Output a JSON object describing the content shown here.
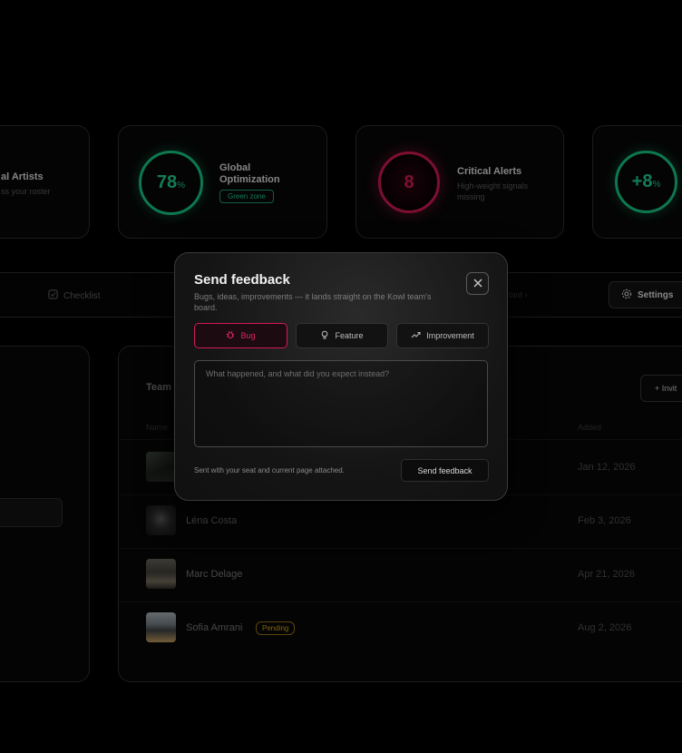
{
  "stats": [
    {
      "title": "al Artists",
      "subtitle": "ss your roster"
    },
    {
      "value": "78",
      "unit": "%",
      "title_line1": "Global",
      "title_line2": "Optimization",
      "badge": "Green zone",
      "accent": "#14b87a"
    },
    {
      "value": "8",
      "title": "Critical Alerts",
      "subtitle_line1": "High-weight signals",
      "subtitle_line2": "missing",
      "accent": "#c1184c"
    },
    {
      "value": "+8",
      "unit": "%",
      "accent": "#14b87a"
    }
  ],
  "toolbar": {
    "checklist_label": "Checklist",
    "hidden_label": "tant",
    "settings_label": "Settings"
  },
  "team": {
    "title": "Team",
    "invite_label": "+ Invit",
    "col_name": "Name",
    "col_added": "Added",
    "members": [
      {
        "name": "",
        "added": "Jan 12, 2026"
      },
      {
        "name": "Léna Costa",
        "added": "Feb 3, 2026"
      },
      {
        "name": "Marc Delage",
        "added": "Apr 21, 2026"
      },
      {
        "name": "Sofia Amrani",
        "added": "Aug 2, 2026",
        "badge": "Pending"
      }
    ]
  },
  "modal": {
    "title": "Send feedback",
    "subtitle": "Bugs, ideas, improvements — it lands straight on the Kowl team's board.",
    "types": [
      {
        "label": "Bug",
        "icon": "bug-icon",
        "active": true
      },
      {
        "label": "Feature",
        "icon": "lightbulb-icon",
        "active": false
      },
      {
        "label": "Improvement",
        "icon": "trend-up-icon",
        "active": false
      }
    ],
    "textarea_placeholder": "What happened, and what did you expect instead?",
    "footer_note": "Sent with your seat and current page attached.",
    "send_label": "Send feedback",
    "accent": "#d1195b"
  }
}
